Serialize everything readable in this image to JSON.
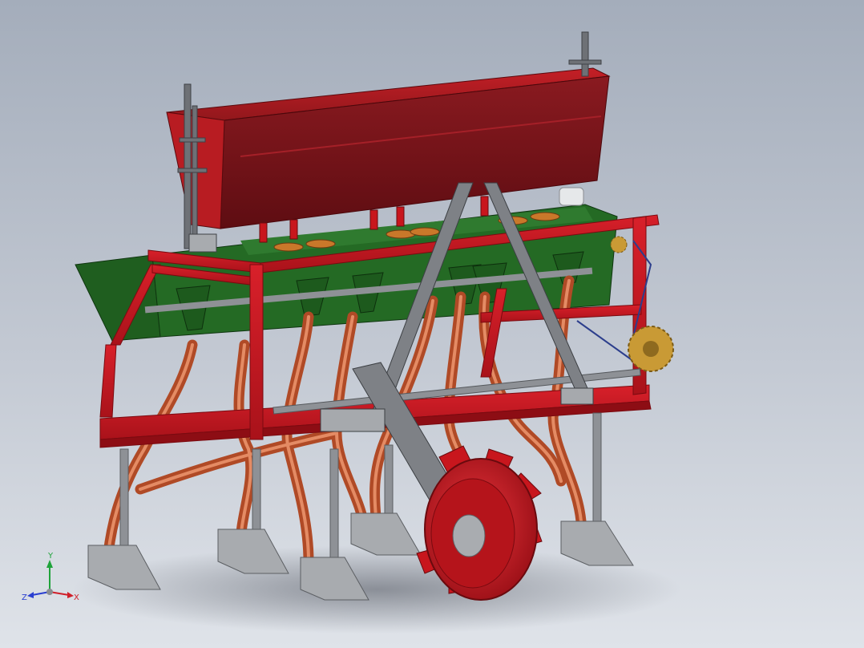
{
  "viewport": {
    "background_top": "#a4adbb",
    "background_bottom": "#dfe3e9"
  },
  "model": {
    "type": "seed drill assembly (3D CAD model)",
    "colors": {
      "frame_red": "#c8161d",
      "hopper_red": "#8e1a1f",
      "tube_copper": "#d4673f",
      "metering_green": "#1d5a1d",
      "steel_gray": "#8a8d91",
      "sprocket_gold": "#c99a35",
      "chain_blue": "#2c3e8c"
    }
  },
  "triad": {
    "x_label": "X",
    "y_label": "Y",
    "z_label": "Z",
    "x_color": "#d0202a",
    "y_color": "#1fa33a",
    "z_color": "#2a3fd0"
  }
}
